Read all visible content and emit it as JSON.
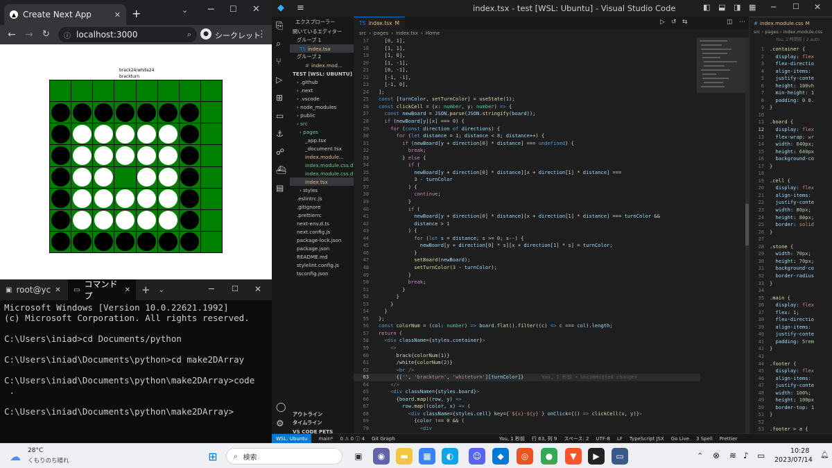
{
  "chrome": {
    "tab_title": "Create Next App",
    "url": "localhost:3000",
    "incognito_label": "シークレット",
    "score_text": "brack24/white24",
    "turn_text": "brackturn",
    "board": [
      [
        0,
        0,
        0,
        0,
        0,
        0,
        0,
        0
      ],
      [
        1,
        1,
        1,
        1,
        1,
        1,
        1,
        0
      ],
      [
        1,
        2,
        2,
        2,
        2,
        2,
        1,
        0
      ],
      [
        1,
        2,
        2,
        2,
        2,
        2,
        1,
        0
      ],
      [
        1,
        2,
        2,
        0,
        2,
        2,
        1,
        0
      ],
      [
        1,
        2,
        2,
        2,
        2,
        2,
        1,
        0
      ],
      [
        1,
        2,
        2,
        2,
        2,
        2,
        1,
        0
      ],
      [
        1,
        1,
        1,
        1,
        1,
        1,
        1,
        0
      ]
    ],
    "colors": {
      "green": "#008000",
      "black": "#000000",
      "white": "#ffffff"
    }
  },
  "terminal": {
    "tab1": "root@yc",
    "tab2": "コマンド プ",
    "lines": [
      "Microsoft Windows [Version 10.0.22621.1992]",
      "(c) Microsoft Corporation. All rights reserved.",
      "",
      "C:\\Users\\iniad>cd Documents/python",
      "",
      "C:\\Users\\iniad\\Documents\\python>cd make2DArray",
      "",
      "C:\\Users\\iniad\\Documents\\python\\make2DArray>code",
      " .",
      "",
      "C:\\Users\\iniad\\Documents\\python\\make2DArray>"
    ]
  },
  "vscode": {
    "title": "index.tsx - test [WSL: Ubuntu] - Visual Studio Code",
    "explorer_title": "エクスプローラー",
    "open_editors": "開いているエディター",
    "group1": "グループ 1",
    "group2": "グループ 2",
    "group1_file": "index.tsx",
    "group2_file": "index.mod...",
    "workspace": "TEST [WSL: UBUNTU]",
    "tree": [
      ".github",
      ".next",
      ".vscode",
      "node_modules",
      "public",
      "src",
      "pages",
      "_app.tsx",
      "_document.tsx",
      "index.module...",
      "index.module.css.d...",
      "index.module.css.d...",
      "index.tsx",
      "styles",
      ".eslintrc.js",
      ".gitignore",
      ".prettierrc",
      "next-env.d.ts",
      "next.config.js",
      "package-lock.json",
      "package.json",
      "README.md",
      "stylelint.config.js",
      "tsconfig.json"
    ],
    "outline": "アウトライン",
    "timeline": "タイムライン",
    "pets": "VS CODE PETS",
    "tab_main": "index.tsx",
    "tab_main_mark": "M",
    "tab_side": "index.module.css",
    "tab_side_mark": "M",
    "breadcrumb": [
      "src",
      "pages",
      "index.tsx",
      "Home"
    ],
    "side_breadcrumb": [
      "src",
      "pages",
      "index.module.css"
    ],
    "side_blame": "You, 2 時間前 | 2 auth",
    "blame": "You, 1 秒前 • Uncommitted changes",
    "status": {
      "remote": "WSL: Ubuntu",
      "branch": "main*",
      "errors": "0 ⚠ 0 ⓘ 4",
      "graph": "Git Graph",
      "blame": "You, 1 秒前",
      "pos": "行 63, 列 9",
      "spaces": "スペース: 2",
      "enc": "UTF-8",
      "eol": "LF",
      "lang": "TypeScript JSX",
      "live": "Go Live",
      "spell": "3 Spell",
      "prettier": "Prettier"
    }
  },
  "taskbar": {
    "temp": "28°C",
    "weather": "くもりのち晴れ",
    "search": "検索",
    "time": "10:28",
    "date": "2023/07/14"
  }
}
